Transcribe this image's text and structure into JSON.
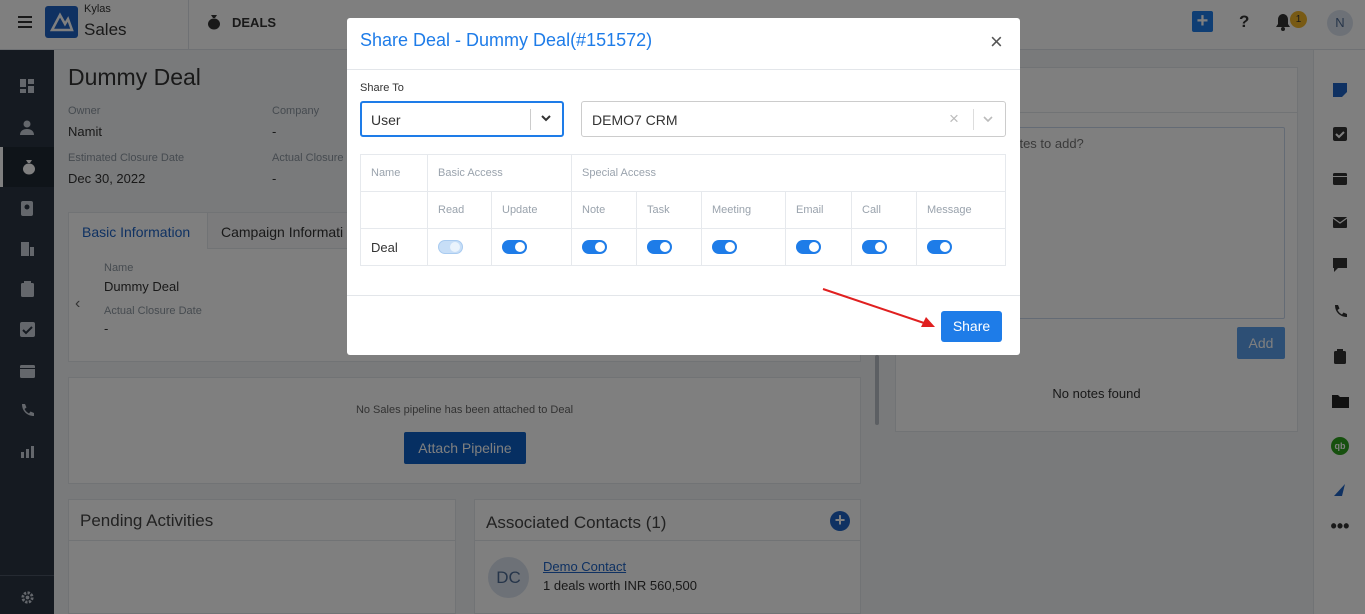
{
  "app": {
    "brand_small": "Kylas",
    "brand_big": "Sales",
    "module": "DEALS",
    "notif_count": "1",
    "avatar_letter": "N"
  },
  "deal": {
    "title": "Dummy Deal",
    "owner_label": "Owner",
    "owner": "Namit",
    "company_label": "Company",
    "company": "-",
    "est_close_label": "Estimated Closure Date",
    "est_close": "Dec 30, 2022",
    "act_close_label": "Actual Closure",
    "act_close": "-"
  },
  "tabs": [
    "Basic Information",
    "Campaign Informati"
  ],
  "basic_info": {
    "name_label": "Name",
    "name": "Dummy Deal",
    "act_label": "Actual Closure Date",
    "act": "-"
  },
  "pipeline": {
    "message": "No Sales pipeline has been attached to Deal",
    "button": "Attach Pipeline"
  },
  "pending": {
    "title": "Pending Activities"
  },
  "contacts": {
    "title": "Associated Contacts (1)",
    "initials": "DC",
    "name": "Demo Contact",
    "summary": "1 deals worth INR 560,500"
  },
  "notes": {
    "placeholder": "notes to add?",
    "add_button": "Add",
    "empty": "No notes found"
  },
  "modal": {
    "title": "Share Deal - Dummy Deal(#151572)",
    "share_to_label": "Share To",
    "share_type": "User",
    "share_target": "DEMO7 CRM",
    "table": {
      "group_name": "Name",
      "group_basic": "Basic Access",
      "group_special": "Special Access",
      "columns": [
        "Read",
        "Update",
        "Note",
        "Task",
        "Meeting",
        "Email",
        "Call",
        "Message"
      ],
      "row_label": "Deal"
    },
    "share_button": "Share"
  },
  "colors": {
    "primary": "#1e7ce8",
    "nav": "#2a3442",
    "attach": "#0d5fc4"
  }
}
